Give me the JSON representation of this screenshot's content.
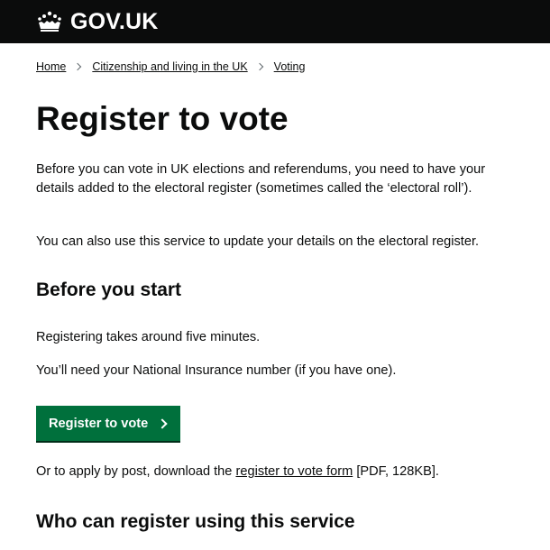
{
  "header": {
    "logo_text": "GOV.UK"
  },
  "breadcrumbs": {
    "items": [
      "Home",
      "Citizenship and living in the UK",
      "Voting"
    ]
  },
  "main": {
    "title": "Register to vote",
    "intro_1": "Before you can vote in UK elections and referendums, you need to have your details added to the electoral register (sometimes called the ‘electoral roll’).",
    "intro_2": "You can also use this service to update your details on the electoral register.",
    "before_heading": "Before you start",
    "time_text": "Registering takes around five minutes.",
    "ni_text": "You’ll need your National Insurance number (if you have one).",
    "start_button_label": "Register to vote",
    "post_text_before": "Or to apply by post, download the ",
    "post_link": "register to vote form",
    "post_text_after": " [PDF, 128KB].",
    "who_heading": "Who can register using this service"
  },
  "colors": {
    "header_bg": "#0b0c0c",
    "button_green": "#00703c",
    "text": "#0b0c0c"
  },
  "icons": {
    "logo": "crown-icon",
    "breadcrumb_separator": "chevron-right-icon",
    "button_arrow": "chevron-right-icon"
  }
}
